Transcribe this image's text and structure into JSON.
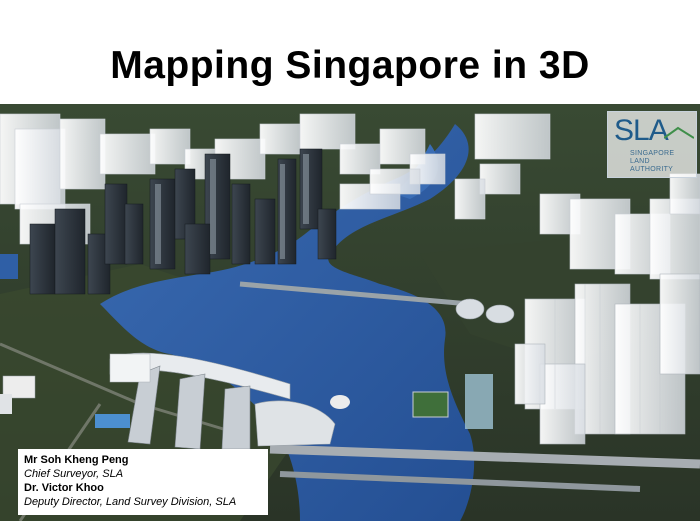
{
  "slide": {
    "title": "Mapping Singapore in 3D"
  },
  "logo": {
    "letters": "SLA",
    "name_line1": "SINGAPORE",
    "name_line2": "LAND AUTHORITY"
  },
  "credits": {
    "presenter1_name": "Mr Soh Kheng Peng",
    "presenter1_role": "Chief Surveyor, SLA",
    "presenter2_name": "Dr. Victor Khoo",
    "presenter2_role": "Deputy Director, Land Survey Division, SLA"
  },
  "colors": {
    "water": "#2f5fa6",
    "logo_blue": "#1f5b8a"
  }
}
